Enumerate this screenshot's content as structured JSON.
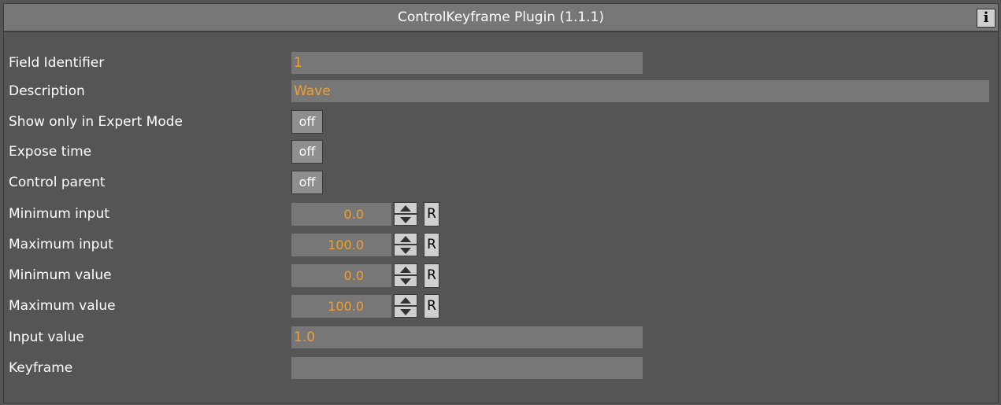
{
  "window": {
    "title": "ControlKeyframe Plugin (1.1.1)",
    "info_button": "i"
  },
  "colors": {
    "background": "#555555",
    "field": "#777777",
    "value_text": "#f0a030",
    "button": "#cfcfcf"
  },
  "rows": {
    "field_identifier": {
      "label": "Field Identifier",
      "value": "1"
    },
    "description": {
      "label": "Description",
      "value": "Wave"
    },
    "show_expert": {
      "label": "Show only in Expert Mode",
      "value": "off"
    },
    "expose_time": {
      "label": "Expose time",
      "value": "off"
    },
    "control_parent": {
      "label": "Control parent",
      "value": "off"
    },
    "min_input": {
      "label": "Minimum input",
      "value": "0.0",
      "reset": "R"
    },
    "max_input": {
      "label": "Maximum input",
      "value": "100.0",
      "reset": "R"
    },
    "min_value": {
      "label": "Minimum value",
      "value": "0.0",
      "reset": "R"
    },
    "max_value": {
      "label": "Maximum value",
      "value": "100.0",
      "reset": "R"
    },
    "input_value": {
      "label": "Input value",
      "value": "1.0"
    },
    "keyframe": {
      "label": "Keyframe",
      "value": ""
    }
  }
}
